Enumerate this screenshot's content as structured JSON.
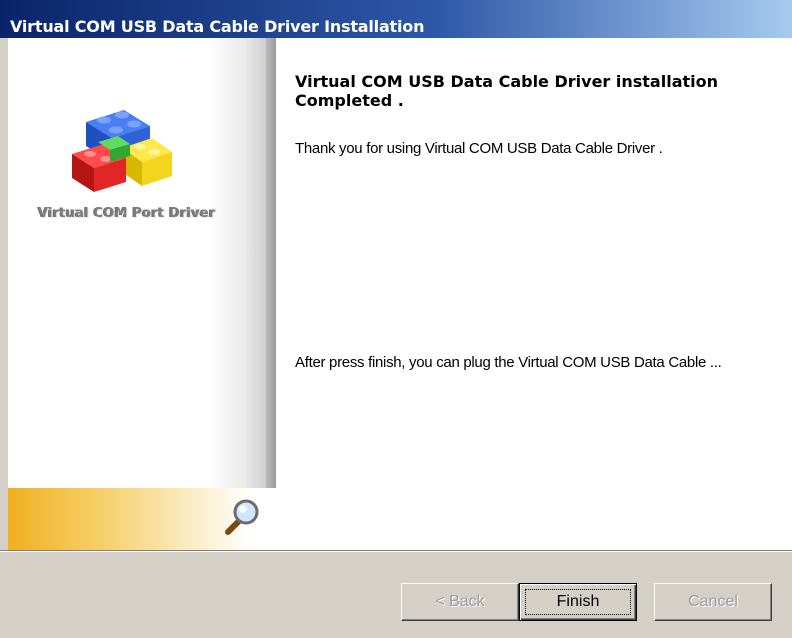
{
  "window": {
    "title": "Virtual COM USB Data Cable Driver Installation"
  },
  "sidebar": {
    "caption": "Virtual COM Port Driver",
    "logo_icon": "lego-blocks-icon",
    "footer_icon": "magnifier-icon"
  },
  "main": {
    "heading": "Virtual COM USB Data Cable Driver installation Completed .",
    "thank_you": "Thank you for using Virtual COM USB Data Cable Driver .",
    "instruction": "After press finish, you can plug the Virtual COM USB Data Cable ..."
  },
  "buttons": {
    "back": "< Back",
    "finish": "Finish",
    "cancel": "Cancel"
  },
  "colors": {
    "title_bar": "#0a246a",
    "dialog_face": "#d4d0c8",
    "footer_gradient": "#f0b020"
  }
}
